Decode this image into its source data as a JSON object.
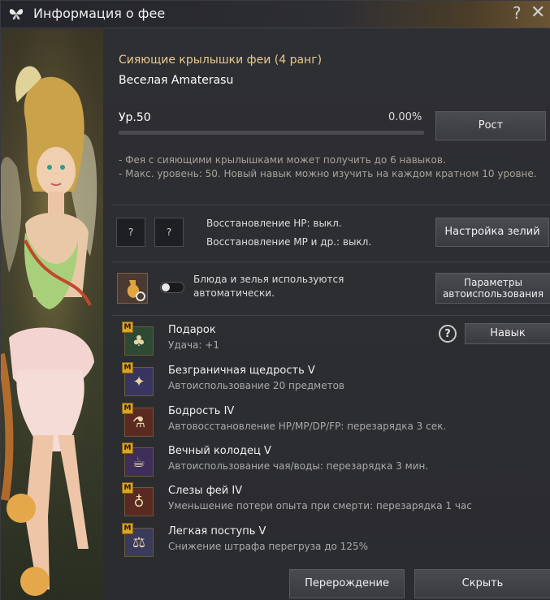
{
  "window": {
    "title": "Информация о фее",
    "help_label": "?",
    "close_label": "✕"
  },
  "fairy": {
    "name": "Сияющие крылышки феи (4 ранг)",
    "nickname": "Веселая Amaterasu",
    "level": "Ур.50",
    "exp_percent": "0.00%",
    "exp_fill": 0,
    "grow_button": "Рост",
    "notes": [
      "- Фея с сияющими крылышками может получить до 6 навыков.",
      "- Макс. уровень: 50. Новый навык можно изучить на каждом кратном 10 уровне."
    ]
  },
  "recovery": {
    "slot1": "?",
    "slot2": "?",
    "hp": "Восстановление HP: выкл.",
    "mp": "Восстановление MP и др.: выкл.",
    "button": "Настройка зелий"
  },
  "auto_use": {
    "text": "Блюда и зелья используются автоматически.",
    "toggle_on": false,
    "button": "Параметры автоиспользования"
  },
  "skills_section": {
    "help_label": "?",
    "skill_button": "Навык",
    "badge": "M"
  },
  "skills": [
    {
      "name": "Подарок",
      "desc": "Удача: +1",
      "icon": "clover-icon",
      "color": "#2e4a35"
    },
    {
      "name": "Безграничная щедрость V",
      "desc": "Автоиспользование 20 предметов",
      "icon": "fairy-icon",
      "color": "#3a3560"
    },
    {
      "name": "Бодрость IV",
      "desc": "Автовосстановление HP/MP/DP/FP: перезарядка 3 сек.",
      "icon": "potion-icon",
      "color": "#5a2a20"
    },
    {
      "name": "Вечный колодец V",
      "desc": "Автоиспользование чая/воды: перезарядка 3 мин.",
      "icon": "teacup-icon",
      "color": "#3d2e5a"
    },
    {
      "name": "Слезы фей IV",
      "desc": "Уменьшение потери опыта при смерти: перезарядка 1 час",
      "icon": "tear-icon",
      "color": "#5a2a22"
    },
    {
      "name": "Легкая поступь V",
      "desc": "Снижение штрафа перегруза до 125%",
      "icon": "weight-icon",
      "color": "#3a3a5a"
    }
  ],
  "footer": {
    "rebirth_button": "Перерождение",
    "hide_button": "Скрыть"
  }
}
